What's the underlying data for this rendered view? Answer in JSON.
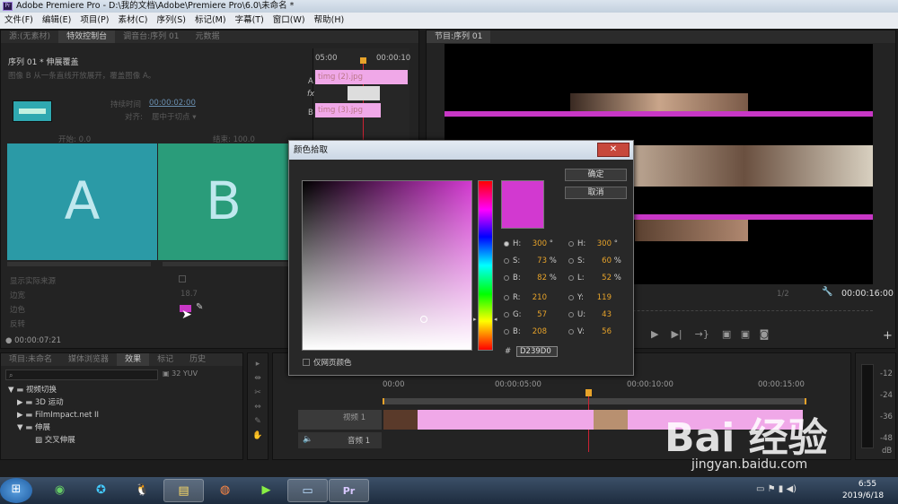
{
  "titlebar": {
    "title": "Adobe Premiere Pro - D:\\我的文档\\Adobe\\Premiere Pro\\6.0\\未命名 *"
  },
  "menu": [
    "文件(F)",
    "编辑(E)",
    "项目(P)",
    "素材(C)",
    "序列(S)",
    "标记(M)",
    "字幕(T)",
    "窗口(W)",
    "帮助(H)"
  ],
  "source_tabs": [
    "源:(无素材)",
    "特效控制台",
    "调音台:序列 01",
    "元数据"
  ],
  "effect_controls": {
    "header": "序列 01 * 伸展覆盖",
    "desc": "图像 B 从一条直线开放展开，覆盖图像 A。",
    "duration_label": "持续时间",
    "duration_value": "00:00:02:00",
    "align_label": "对齐:",
    "align_value": "居中于切点",
    "start_label": "开始:",
    "start_value": "0.0",
    "end_label": "结束:",
    "end_value": "100.0",
    "tile_a": "A",
    "tile_b": "B",
    "show_actual": "显示实际来源",
    "border_width_label": "边宽",
    "border_width_value": "18.7",
    "border_color_label": "边色",
    "reverse_label": "反转",
    "timecode": "00:00:07:21",
    "mini_time_left": "05:00",
    "mini_time_right": "00:00:10",
    "track_a": "A",
    "track_fx": "fx",
    "track_b": "B",
    "clip_a": "timg (2).jpg",
    "clip_b": "timg (3).jpg"
  },
  "program": {
    "tab": "节目:序列 01",
    "zoom": "1/2",
    "timecode": "00:00:16:00"
  },
  "project_tabs": [
    "项目:未命名",
    "媒体浏览器",
    "效果",
    "标记",
    "历史"
  ],
  "effects_tree": [
    {
      "label": "视频切换",
      "indent": 0,
      "open": true
    },
    {
      "label": "3D 运动",
      "indent": 1,
      "open": false
    },
    {
      "label": "FilmImpact.net II",
      "indent": 1,
      "open": false
    },
    {
      "label": "伸展",
      "indent": 1,
      "open": true
    },
    {
      "label": "交叉伸展",
      "indent": 2,
      "open": false
    }
  ],
  "timeline": {
    "times": [
      "00:00",
      "00:00:05:00",
      "00:00:10:00",
      "00:00:15:00"
    ],
    "video_track": "视频 1",
    "audio_track": "音频 1"
  },
  "meter": {
    "ticks": [
      "-12",
      "-24",
      "-36",
      "-48",
      "dB"
    ]
  },
  "dialog": {
    "title": "颜色拾取",
    "ok": "确定",
    "cancel": "取消",
    "hsb_left": [
      {
        "l": "H:",
        "v": "300",
        "u": "°"
      },
      {
        "l": "S:",
        "v": "73",
        "u": "%"
      },
      {
        "l": "B:",
        "v": "82",
        "u": "%"
      }
    ],
    "hsl_right": [
      {
        "l": "H:",
        "v": "300",
        "u": "°"
      },
      {
        "l": "S:",
        "v": "60",
        "u": "%"
      },
      {
        "l": "L:",
        "v": "52",
        "u": "%"
      }
    ],
    "rgb": [
      {
        "l": "R:",
        "v": "210"
      },
      {
        "l": "G:",
        "v": "57"
      },
      {
        "l": "B:",
        "v": "208"
      }
    ],
    "yuv": [
      {
        "l": "Y:",
        "v": "119"
      },
      {
        "l": "U:",
        "v": "43"
      },
      {
        "l": "V:",
        "v": "56"
      }
    ],
    "hex_label": "#",
    "hex": "D239D0",
    "web_only": "仅网页颜色",
    "color": "#d239d0"
  },
  "clock": {
    "time": "6:55",
    "date": "2019/6/18"
  },
  "watermark": {
    "main": "Bai 经验",
    "sub": "jingyan.baidu.com"
  }
}
